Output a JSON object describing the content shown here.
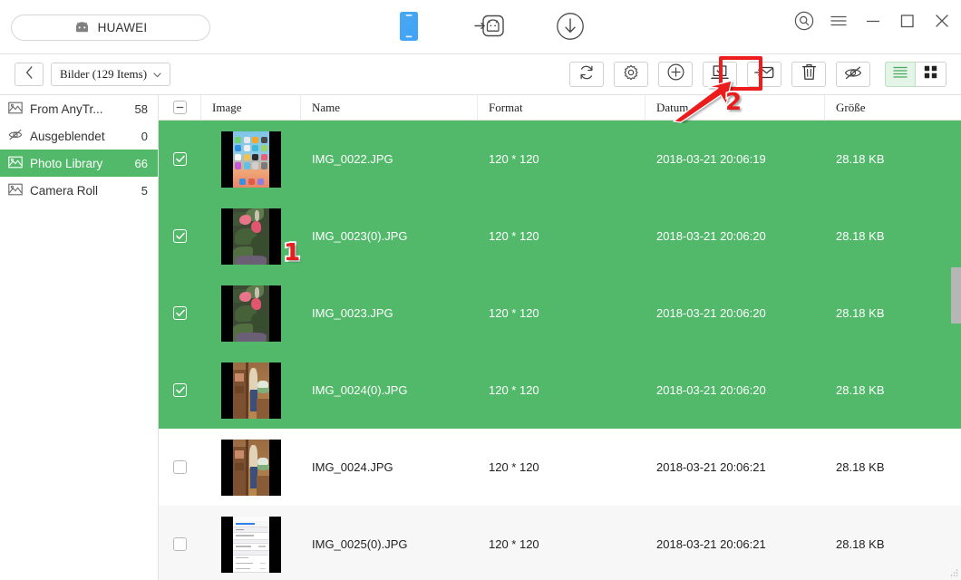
{
  "window": {
    "device_label": "HUAWEI",
    "device_icon": "android-icon",
    "nav": [
      {
        "name": "device-tab",
        "icon": "phone-icon",
        "active": true
      },
      {
        "name": "transfer-tab",
        "icon": "android-transfer-icon",
        "active": false
      },
      {
        "name": "download-tab",
        "icon": "download-circle-icon",
        "active": false
      }
    ],
    "controls": [
      {
        "name": "search-button",
        "icon": "search-circle-icon"
      },
      {
        "name": "menu-button",
        "icon": "hamburger-icon"
      },
      {
        "name": "minimize-button",
        "icon": "minimize-icon"
      },
      {
        "name": "maximize-button",
        "icon": "maximize-icon"
      },
      {
        "name": "close-button",
        "icon": "close-icon"
      }
    ]
  },
  "subbar": {
    "back_icon": "chevron-left-icon",
    "breadcrumb": "Bilder (129 Items)",
    "breadcrumb_caret": "chevron-down-icon",
    "tools": [
      {
        "name": "refresh-button",
        "icon": "refresh-icon",
        "highlighted": false
      },
      {
        "name": "settings-button",
        "icon": "gear-icon",
        "highlighted": false
      },
      {
        "name": "add-button",
        "icon": "plus-circle-icon",
        "highlighted": false
      },
      {
        "name": "export-to-pc-button",
        "icon": "export-to-computer-icon",
        "highlighted": true
      },
      {
        "name": "import-button",
        "icon": "import-to-device-icon",
        "highlighted": false
      },
      {
        "name": "delete-button",
        "icon": "trash-icon",
        "highlighted": false
      },
      {
        "name": "hide-button",
        "icon": "eye-slash-icon",
        "highlighted": false
      }
    ],
    "views": [
      {
        "name": "list-view-button",
        "icon": "list-view-icon",
        "active": true
      },
      {
        "name": "grid-view-button",
        "icon": "grid-view-icon",
        "active": false
      }
    ]
  },
  "sidebar": {
    "items": [
      {
        "label": "From AnyTr...",
        "count": "58",
        "icon": "photo-icon",
        "active": false
      },
      {
        "label": "Ausgeblendet",
        "count": "0",
        "icon": "eye-slash-icon",
        "active": false
      },
      {
        "label": "Photo Library",
        "count": "66",
        "icon": "photo-icon",
        "active": true
      },
      {
        "label": "Camera Roll",
        "count": "5",
        "icon": "photo-icon",
        "active": false
      }
    ]
  },
  "table": {
    "select_all_state": "indeterminate",
    "columns": [
      "Image",
      "Name",
      "Format",
      "Datum",
      "Größe"
    ],
    "rows": [
      {
        "checked": true,
        "selected": true,
        "alt": false,
        "art": "ios",
        "name": "IMG_0022.JPG",
        "format": "120 * 120",
        "date": "2018-03-21 20:06:19",
        "size": "28.18 KB"
      },
      {
        "checked": true,
        "selected": true,
        "alt": false,
        "art": "plant",
        "name": "IMG_0023(0).JPG",
        "format": "120 * 120",
        "date": "2018-03-21 20:06:20",
        "size": "28.18 KB"
      },
      {
        "checked": true,
        "selected": true,
        "alt": false,
        "art": "plant",
        "name": "IMG_0023.JPG",
        "format": "120 * 120",
        "date": "2018-03-21 20:06:20",
        "size": "28.18 KB"
      },
      {
        "checked": true,
        "selected": true,
        "alt": false,
        "art": "room",
        "name": "IMG_0024(0).JPG",
        "format": "120 * 120",
        "date": "2018-03-21 20:06:20",
        "size": "28.18 KB"
      },
      {
        "checked": false,
        "selected": false,
        "alt": false,
        "art": "room",
        "name": "IMG_0024.JPG",
        "format": "120 * 120",
        "date": "2018-03-21 20:06:21",
        "size": "28.18 KB"
      },
      {
        "checked": false,
        "selected": false,
        "alt": true,
        "art": "settings",
        "name": "IMG_0025(0).JPG",
        "format": "120 * 120",
        "date": "2018-03-21 20:06:21",
        "size": "28.18 KB"
      }
    ]
  },
  "annotations": [
    {
      "name": "step-1-marker",
      "label": "1"
    },
    {
      "name": "step-2-marker",
      "label": "2"
    }
  ],
  "colors": {
    "selection_green": "#52b96b",
    "annotation_red": "#e81d1d",
    "alt_row": "#f7f7f7"
  }
}
